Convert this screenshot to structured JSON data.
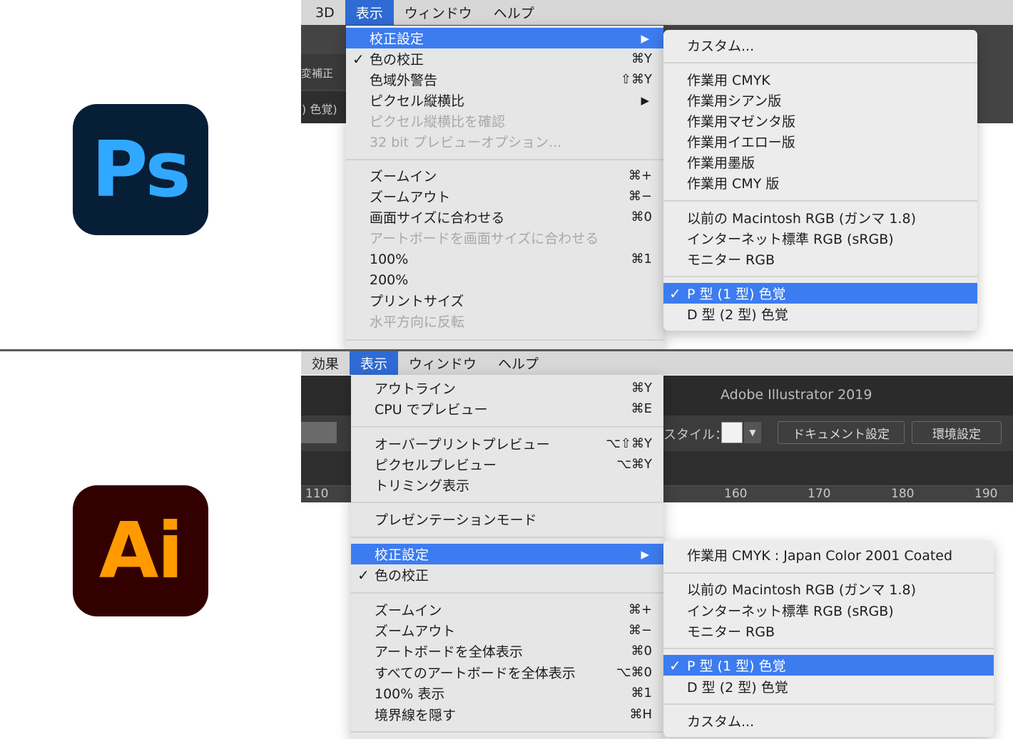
{
  "photoshop": {
    "logo_text": "Ps",
    "menubar": [
      "3D",
      "表示",
      "ウィンドウ",
      "ヘルプ"
    ],
    "bg_fragments": [
      "変補正",
      ") 色覚)"
    ],
    "menu": [
      {
        "label": "校正設定",
        "shortcut": "",
        "arrow": "▶"
      },
      {
        "label": "色の校正",
        "check": "✓",
        "shortcut": "⌘Y"
      },
      {
        "label": "色域外警告",
        "shortcut": "⇧⌘Y"
      },
      {
        "label": "ピクセル縦横比",
        "shortcut": "",
        "arrow": "▶"
      },
      {
        "label": "ピクセル縦横比を確認",
        "shortcut": ""
      },
      {
        "label": "32 bit プレビューオプション...",
        "shortcut": ""
      },
      {
        "label": "ズームイン",
        "shortcut": "⌘+"
      },
      {
        "label": "ズームアウト",
        "shortcut": "⌘−"
      },
      {
        "label": "画面サイズに合わせる",
        "shortcut": "⌘0"
      },
      {
        "label": "アートボードを画面サイズに合わせる",
        "shortcut": ""
      },
      {
        "label": "100%",
        "shortcut": "⌘1"
      },
      {
        "label": "200%",
        "shortcut": ""
      },
      {
        "label": "プリントサイズ",
        "shortcut": ""
      },
      {
        "label": "水平方向に反転",
        "shortcut": ""
      }
    ],
    "submenu": [
      {
        "label": "カスタム..."
      },
      {
        "label": "作業用 CMYK"
      },
      {
        "label": "作業用シアン版"
      },
      {
        "label": "作業用マゼンタ版"
      },
      {
        "label": "作業用イエロー版"
      },
      {
        "label": "作業用墨版"
      },
      {
        "label": "作業用 CMY 版"
      },
      {
        "label": "以前の Macintosh RGB (ガンマ 1.8)"
      },
      {
        "label": "インターネット標準 RGB (sRGB)"
      },
      {
        "label": "モニター RGB"
      },
      {
        "label": "P 型 (1 型) 色覚",
        "check": "✓"
      },
      {
        "label": "D 型 (2 型) 色覚"
      }
    ]
  },
  "illustrator": {
    "logo_text": "Ai",
    "menubar": [
      "効果",
      "表示",
      "ウィンドウ",
      "ヘルプ"
    ],
    "window_title": "Adobe Illustrator 2019",
    "style_label": "スタイル：",
    "doc_settings_button": "ドキュメント設定",
    "prefs_button": "環境設定",
    "ruler_ticks": [
      "110",
      "160",
      "170",
      "180",
      "190"
    ],
    "menu": [
      {
        "label": "アウトライン",
        "shortcut": "⌘Y"
      },
      {
        "label": "CPU でプレビュー",
        "shortcut": "⌘E"
      },
      {
        "label": "オーバープリントプレビュー",
        "shortcut": "⌥⇧⌘Y"
      },
      {
        "label": "ピクセルプレビュー",
        "shortcut": "⌥⌘Y"
      },
      {
        "label": "トリミング表示",
        "shortcut": ""
      },
      {
        "label": "プレゼンテーションモード",
        "shortcut": ""
      },
      {
        "label": "校正設定",
        "shortcut": "",
        "arrow": "▶"
      },
      {
        "label": "色の校正",
        "check": "✓",
        "shortcut": ""
      },
      {
        "label": "ズームイン",
        "shortcut": "⌘+"
      },
      {
        "label": "ズームアウト",
        "shortcut": "⌘−"
      },
      {
        "label": "アートボードを全体表示",
        "shortcut": "⌘0"
      },
      {
        "label": "すべてのアートボードを全体表示",
        "shortcut": "⌥⌘0"
      },
      {
        "label": "100% 表示",
        "shortcut": "⌘1"
      },
      {
        "label": "境界線を隠す",
        "shortcut": "⌘H"
      }
    ],
    "submenu": [
      {
        "label": "作業用 CMYK : Japan Color 2001 Coated"
      },
      {
        "label": "以前の Macintosh RGB (ガンマ 1.8)"
      },
      {
        "label": "インターネット標準 RGB (sRGB)"
      },
      {
        "label": "モニター RGB"
      },
      {
        "label": "P 型 (1 型) 色覚",
        "check": "✓"
      },
      {
        "label": "D 型 (2 型) 色覚"
      },
      {
        "label": "カスタム..."
      }
    ]
  },
  "colors": {
    "highlight": "#3c7cf0",
    "menubar_active": "#2f6bd4",
    "ps_logo_bg": "#061e36",
    "ps_logo_fg": "#31a8ff",
    "ai_logo_bg": "#330000",
    "ai_logo_fg": "#ff9a00"
  }
}
